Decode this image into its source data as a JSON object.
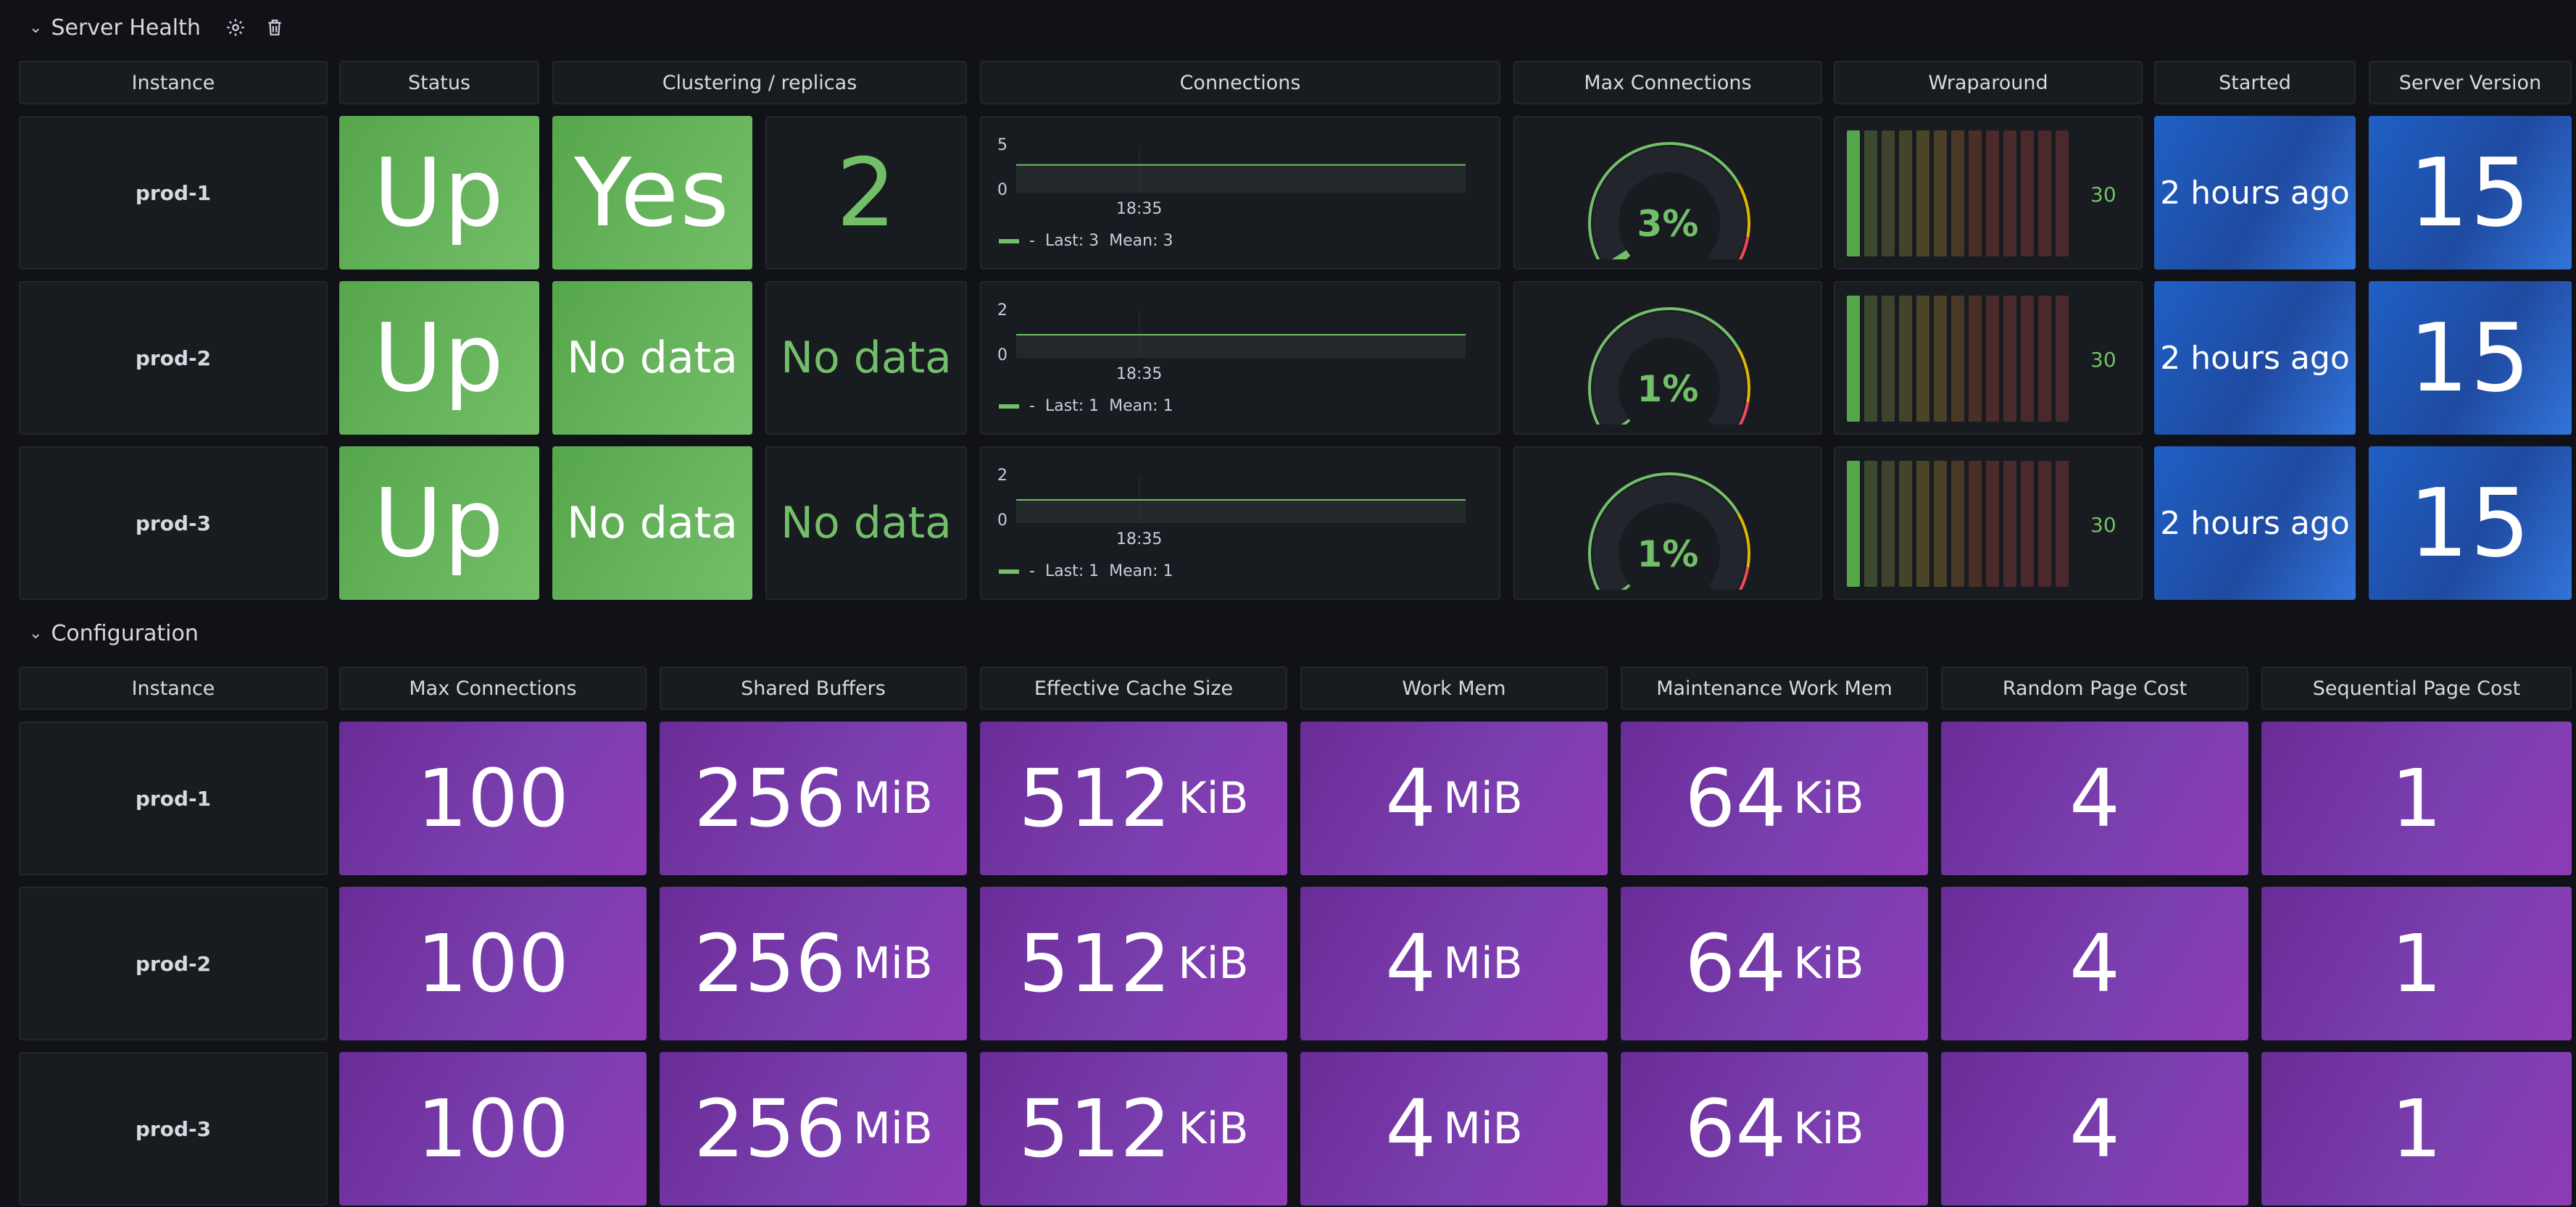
{
  "server_health": {
    "title": "Server Health",
    "columns": [
      "Instance",
      "Status",
      "Clustering / replicas",
      "Connections",
      "Max Connections",
      "Wraparound",
      "Started",
      "Server Version"
    ],
    "rows": [
      {
        "instance": "prod-1",
        "status": "Up",
        "clustering": "Yes",
        "replicas": "2",
        "conn_ymax": "5",
        "conn_ymin": "0",
        "conn_time": "18:35",
        "conn_value": 3,
        "conn_legend": "Last: 3  Mean: 3",
        "maxconn_pct": 3,
        "maxconn_label": "3%",
        "wraparound": "30",
        "started": "2 hours ago",
        "version": "15"
      },
      {
        "instance": "prod-2",
        "status": "Up",
        "clustering": "No data",
        "replicas": "No data",
        "conn_ymax": "2",
        "conn_ymin": "0",
        "conn_time": "18:35",
        "conn_value": 1,
        "conn_legend": "Last: 1  Mean: 1",
        "maxconn_pct": 1,
        "maxconn_label": "1%",
        "wraparound": "30",
        "started": "2 hours ago",
        "version": "15"
      },
      {
        "instance": "prod-3",
        "status": "Up",
        "clustering": "No data",
        "replicas": "No data",
        "conn_ymax": "2",
        "conn_ymin": "0",
        "conn_time": "18:35",
        "conn_value": 1,
        "conn_legend": "Last: 1  Mean: 1",
        "maxconn_pct": 1,
        "maxconn_label": "1%",
        "wraparound": "30",
        "started": "2 hours ago",
        "version": "15"
      }
    ],
    "legend_dash": "-"
  },
  "configuration": {
    "title": "Configuration",
    "columns": [
      "Instance",
      "Max Connections",
      "Shared Buffers",
      "Effective Cache Size",
      "Work Mem",
      "Maintenance Work Mem",
      "Random Page Cost",
      "Sequential Page Cost"
    ],
    "rows": [
      {
        "instance": "prod-1",
        "values": [
          [
            "100",
            ""
          ],
          [
            "256",
            "MiB"
          ],
          [
            "512",
            "KiB"
          ],
          [
            "4",
            "MiB"
          ],
          [
            "64",
            "KiB"
          ],
          [
            "4",
            ""
          ],
          [
            "1",
            ""
          ]
        ]
      },
      {
        "instance": "prod-2",
        "values": [
          [
            "100",
            ""
          ],
          [
            "256",
            "MiB"
          ],
          [
            "512",
            "KiB"
          ],
          [
            "4",
            "MiB"
          ],
          [
            "64",
            "KiB"
          ],
          [
            "4",
            ""
          ],
          [
            "1",
            ""
          ]
        ]
      },
      {
        "instance": "prod-3",
        "values": [
          [
            "100",
            ""
          ],
          [
            "256",
            "MiB"
          ],
          [
            "512",
            "KiB"
          ],
          [
            "4",
            "MiB"
          ],
          [
            "64",
            "KiB"
          ],
          [
            "4",
            ""
          ],
          [
            "1",
            ""
          ]
        ]
      }
    ]
  },
  "colors": {
    "background": "#111217",
    "panel": "#181b1f",
    "green": "#73bf69",
    "blue": "#1f60c4",
    "purple": "#7b3fb0"
  }
}
